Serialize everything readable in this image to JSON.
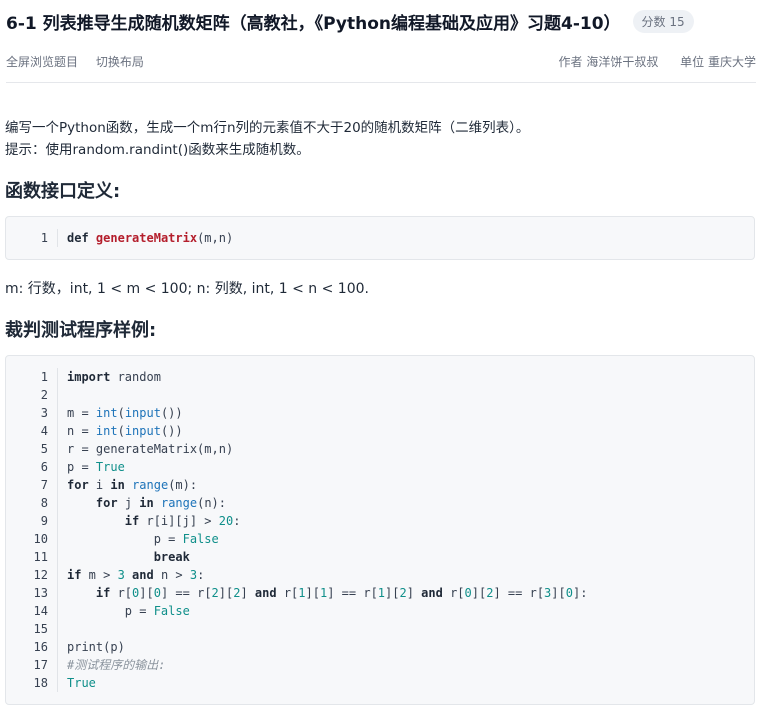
{
  "header": {
    "title": "6-1 列表推导生成随机数矩阵（高教社，《Python编程基础及应用》习题4-10）",
    "score": "分数 15"
  },
  "subbar": {
    "fullscreen": "全屏浏览题目",
    "switch_layout": "切换布局",
    "author": "作者 海洋饼干叔叔",
    "unit": "单位 重庆大学"
  },
  "description": {
    "line1": "编写一个Python函数，生成一个m行n列的元素值不大于20的随机数矩阵（二维列表）。",
    "line2": "提示：使用random.randint()函数来生成随机数。"
  },
  "interface_heading": "函数接口定义:",
  "interface_code": [
    {
      "n": "1",
      "t": [
        [
          "kw",
          "def"
        ],
        [
          "p",
          " "
        ],
        [
          "fn",
          "generateMatrix"
        ],
        [
          "p",
          "(m,n)"
        ]
      ]
    }
  ],
  "params_text": "m: 行数，int, 1 < m < 100; n: 列数, int, 1 < n < 100.",
  "judge_heading": "裁判测试程序样例:",
  "judge_code": [
    {
      "n": "1",
      "t": [
        [
          "kw",
          "import"
        ],
        [
          "p",
          " random"
        ]
      ]
    },
    {
      "n": "2",
      "t": []
    },
    {
      "n": "3",
      "t": [
        [
          "p",
          "m = "
        ],
        [
          "bi",
          "int"
        ],
        [
          "p",
          "("
        ],
        [
          "bi",
          "input"
        ],
        [
          "p",
          "())"
        ]
      ]
    },
    {
      "n": "4",
      "t": [
        [
          "p",
          "n = "
        ],
        [
          "bi",
          "int"
        ],
        [
          "p",
          "("
        ],
        [
          "bi",
          "input"
        ],
        [
          "p",
          "())"
        ]
      ]
    },
    {
      "n": "5",
      "t": [
        [
          "p",
          "r = generateMatrix(m,n)"
        ]
      ]
    },
    {
      "n": "6",
      "t": [
        [
          "p",
          "p = "
        ],
        [
          "lit",
          "True"
        ]
      ]
    },
    {
      "n": "7",
      "t": [
        [
          "kw",
          "for"
        ],
        [
          "p",
          " i "
        ],
        [
          "kw",
          "in"
        ],
        [
          "p",
          " "
        ],
        [
          "bi",
          "range"
        ],
        [
          "p",
          "(m):"
        ]
      ]
    },
    {
      "n": "8",
      "t": [
        [
          "p",
          "    "
        ],
        [
          "kw",
          "for"
        ],
        [
          "p",
          " j "
        ],
        [
          "kw",
          "in"
        ],
        [
          "p",
          " "
        ],
        [
          "bi",
          "range"
        ],
        [
          "p",
          "(n):"
        ]
      ]
    },
    {
      "n": "9",
      "t": [
        [
          "p",
          "        "
        ],
        [
          "kw",
          "if"
        ],
        [
          "p",
          " r[i][j] > "
        ],
        [
          "num",
          "20"
        ],
        [
          "p",
          ":"
        ]
      ]
    },
    {
      "n": "10",
      "t": [
        [
          "p",
          "            p = "
        ],
        [
          "lit",
          "False"
        ]
      ]
    },
    {
      "n": "11",
      "t": [
        [
          "p",
          "            "
        ],
        [
          "kw",
          "break"
        ]
      ]
    },
    {
      "n": "12",
      "t": [
        [
          "kw",
          "if"
        ],
        [
          "p",
          " m > "
        ],
        [
          "num",
          "3"
        ],
        [
          "p",
          " "
        ],
        [
          "kw",
          "and"
        ],
        [
          "p",
          " n > "
        ],
        [
          "num",
          "3"
        ],
        [
          "p",
          ":"
        ]
      ]
    },
    {
      "n": "13",
      "t": [
        [
          "p",
          "    "
        ],
        [
          "kw",
          "if"
        ],
        [
          "p",
          " r["
        ],
        [
          "num",
          "0"
        ],
        [
          "p",
          "]["
        ],
        [
          "num",
          "0"
        ],
        [
          "p",
          "] == r["
        ],
        [
          "num",
          "2"
        ],
        [
          "p",
          "]["
        ],
        [
          "num",
          "2"
        ],
        [
          "p",
          "] "
        ],
        [
          "kw",
          "and"
        ],
        [
          "p",
          " r["
        ],
        [
          "num",
          "1"
        ],
        [
          "p",
          "]["
        ],
        [
          "num",
          "1"
        ],
        [
          "p",
          "] == r["
        ],
        [
          "num",
          "1"
        ],
        [
          "p",
          "]["
        ],
        [
          "num",
          "2"
        ],
        [
          "p",
          "] "
        ],
        [
          "kw",
          "and"
        ],
        [
          "p",
          " r["
        ],
        [
          "num",
          "0"
        ],
        [
          "p",
          "]["
        ],
        [
          "num",
          "2"
        ],
        [
          "p",
          "] == r["
        ],
        [
          "num",
          "3"
        ],
        [
          "p",
          "]["
        ],
        [
          "num",
          "0"
        ],
        [
          "p",
          "]:"
        ]
      ]
    },
    {
      "n": "14",
      "t": [
        [
          "p",
          "        p = "
        ],
        [
          "lit",
          "False"
        ]
      ]
    },
    {
      "n": "15",
      "t": []
    },
    {
      "n": "16",
      "t": [
        [
          "p",
          "print(p)"
        ]
      ]
    },
    {
      "n": "17",
      "t": [
        [
          "cm",
          "#测试程序的输出:"
        ]
      ]
    },
    {
      "n": "18",
      "t": [
        [
          "lit",
          "True"
        ]
      ]
    }
  ]
}
